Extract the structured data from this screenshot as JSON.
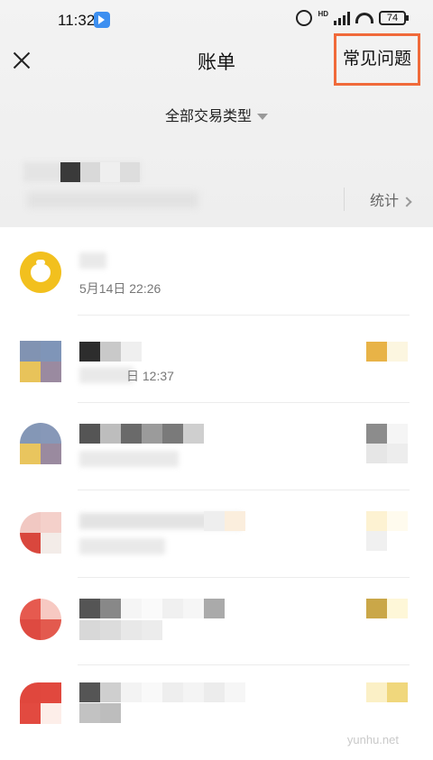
{
  "status_bar": {
    "time": "11:32",
    "hd_label": "HD",
    "battery_level": "74",
    "icons": [
      "alarm-icon",
      "signal-icon",
      "wifi-icon",
      "battery-icon"
    ]
  },
  "nav": {
    "close_icon": "close-icon",
    "title": "账单",
    "faq_label": "常见问题",
    "highlight_color": "#f06a3a"
  },
  "filter": {
    "label": "全部交易类型",
    "caret_icon": "caret-down-icon"
  },
  "month_header": {
    "stats_label": "统计",
    "chevron_icon": "chevron-right-icon"
  },
  "items": [
    {
      "icon": "money-bag-icon",
      "icon_color": "#f2c01e",
      "time": "5月14日 22:26"
    },
    {
      "icon": "avatar",
      "time_fragment": "日 12:37"
    },
    {
      "icon": "avatar"
    },
    {
      "icon": "avatar"
    },
    {
      "icon": "avatar"
    },
    {
      "icon": "avatar"
    }
  ],
  "watermark": "yunhu.net"
}
